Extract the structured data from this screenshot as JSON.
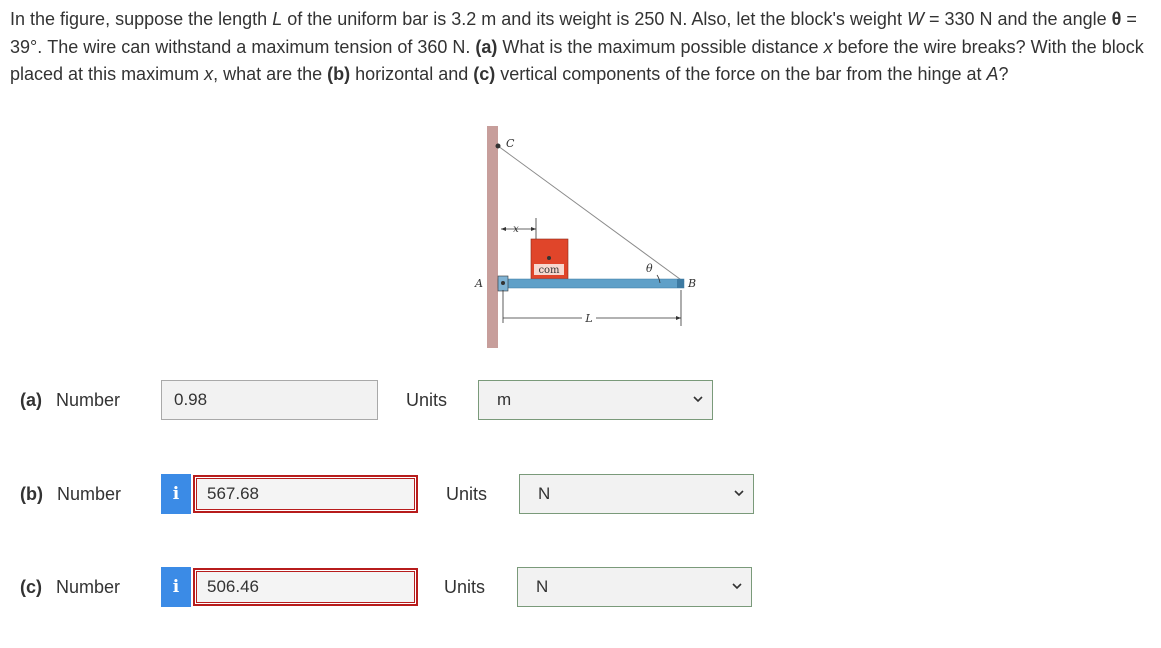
{
  "question": {
    "p1": "In the figure, suppose the length ",
    "L": "L",
    "p2": " of the uniform bar is 3.2 m and its weight is 250 N. Also, let the block's weight ",
    "W": "W",
    "p3": " = 330 N and the angle ",
    "theta": "θ",
    "p4": " = 39°. The wire can withstand a maximum tension of 360 N. ",
    "a": "(a)",
    "p5": " What is the maximum possible distance ",
    "x": "x",
    "p6": " before the wire breaks? With the block placed at this maximum ",
    "x2": "x",
    "p7": ", what are the ",
    "b": "(b)",
    "p8": " horizontal and ",
    "c": "(c)",
    "p9": " vertical components of the force on the bar from the hinge at ",
    "A": "A",
    "p10": "?"
  },
  "figure": {
    "label_C": "C",
    "label_x": "x",
    "label_com": "com",
    "label_theta": "θ",
    "label_A": "A",
    "label_B": "B",
    "label_L": "L",
    "colors": {
      "wall": "#c79e9b",
      "bar": "#5fa0c8",
      "block": "#e0452a"
    }
  },
  "parts": [
    {
      "tag": "(a)",
      "label": "Number",
      "value": "0.98",
      "status": "normal",
      "units_label": "Units",
      "unit": "m"
    },
    {
      "tag": "(b)",
      "label": "Number",
      "value": "567.68",
      "status": "incorrect",
      "info_icon": "i",
      "units_label": "Units",
      "unit": "N"
    },
    {
      "tag": "(c)",
      "label": "Number",
      "value": "506.46",
      "status": "incorrect",
      "info_icon": "i",
      "units_label": "Units",
      "unit": "N"
    }
  ]
}
